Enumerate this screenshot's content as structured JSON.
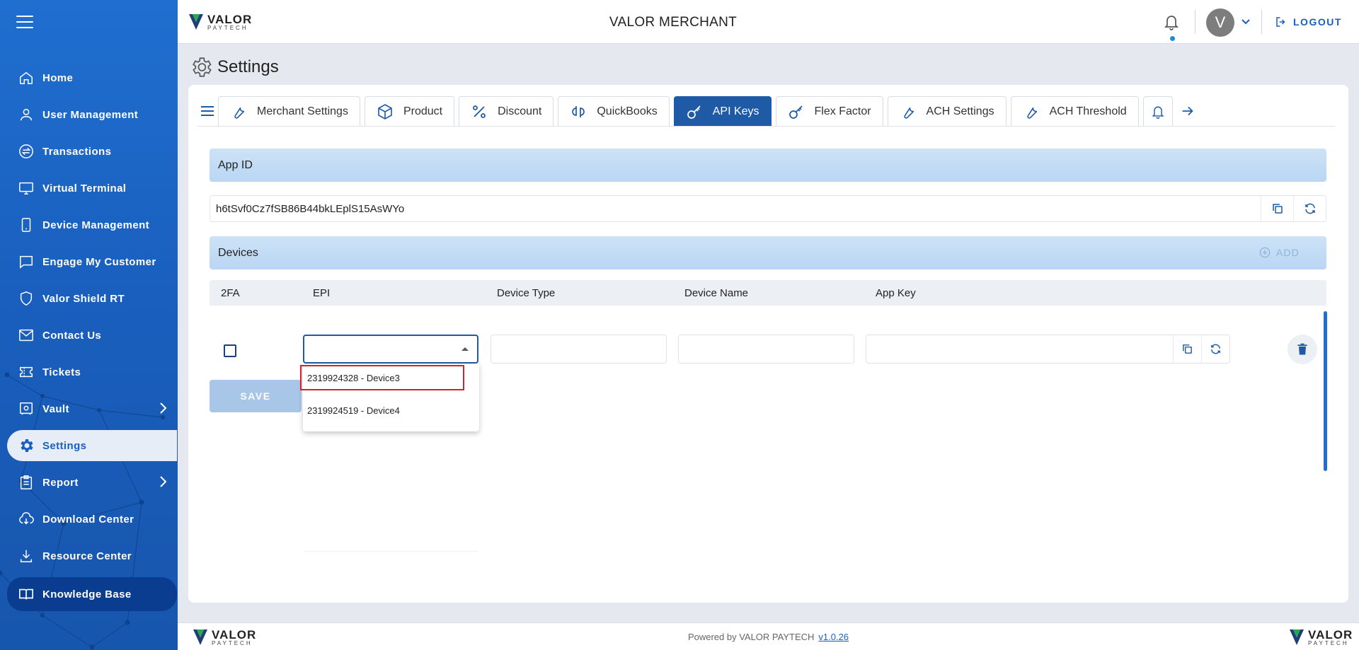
{
  "header": {
    "app_title": "VALOR MERCHANT",
    "logo_main": "VALOR",
    "logo_sub": "PAYTECH",
    "avatar_letter": "V",
    "logout_label": "LOGOUT"
  },
  "sidebar": {
    "items": [
      {
        "label": "Home",
        "icon": "home-icon"
      },
      {
        "label": "User Management",
        "icon": "user-icon"
      },
      {
        "label": "Transactions",
        "icon": "transactions-icon"
      },
      {
        "label": "Virtual Terminal",
        "icon": "monitor-icon"
      },
      {
        "label": "Device Management",
        "icon": "device-icon"
      },
      {
        "label": "Engage My Customer",
        "icon": "chat-icon"
      },
      {
        "label": "Valor Shield RT",
        "icon": "shield-icon"
      },
      {
        "label": "Contact Us",
        "icon": "mail-icon"
      },
      {
        "label": "Tickets",
        "icon": "ticket-icon"
      },
      {
        "label": "Vault",
        "icon": "vault-icon"
      },
      {
        "label": "Settings",
        "icon": "gear-icon"
      },
      {
        "label": "Report",
        "icon": "report-icon"
      },
      {
        "label": "Download Center",
        "icon": "cloud-download-icon"
      },
      {
        "label": "Resource Center",
        "icon": "download-icon"
      },
      {
        "label": "Knowledge Base",
        "icon": "book-icon"
      }
    ]
  },
  "page": {
    "title": "Settings"
  },
  "tabs": [
    {
      "label": "Merchant Settings"
    },
    {
      "label": "Product"
    },
    {
      "label": "Discount"
    },
    {
      "label": "QuickBooks"
    },
    {
      "label": "API Keys"
    },
    {
      "label": "Flex Factor"
    },
    {
      "label": "ACH Settings"
    },
    {
      "label": "ACH Threshold"
    }
  ],
  "app_id": {
    "section_title": "App ID",
    "value": "h6tSvf0Cz7fSB86B44bkLEplS15AsWYo"
  },
  "devices": {
    "section_title": "Devices",
    "add_label": "ADD",
    "columns": [
      "2FA",
      "EPI",
      "Device Type",
      "Device Name",
      "App Key"
    ],
    "save_label": "SAVE",
    "epi_options": [
      "2319924328 - Device3",
      "2319924519 - Device4"
    ]
  },
  "footer": {
    "powered_by": "Powered by VALOR PAYTECH",
    "version": "v1.0.26"
  },
  "colors": {
    "primary": "#1e5aa6",
    "sidebar": "#1f6fd0",
    "highlight_border": "#d0232a"
  }
}
